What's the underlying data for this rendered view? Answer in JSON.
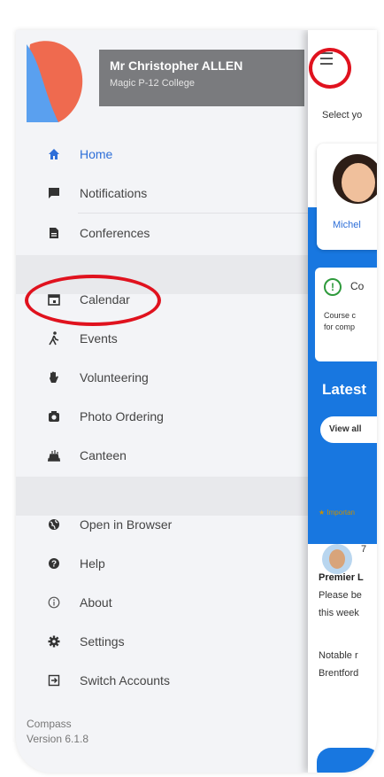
{
  "profile": {
    "name": "Mr Christopher ALLEN",
    "school": "Magic P-12 College"
  },
  "menu_group_1": [
    {
      "label": "Home",
      "icon": "home-icon",
      "active": true
    },
    {
      "label": "Notifications",
      "icon": "notifications-icon"
    },
    {
      "label": "Conferences",
      "icon": "document-icon"
    }
  ],
  "menu_group_2": [
    {
      "label": "Calendar",
      "icon": "calendar-icon"
    },
    {
      "label": "Events",
      "icon": "walk-icon"
    },
    {
      "label": "Volunteering",
      "icon": "hand-icon"
    },
    {
      "label": "Photo Ordering",
      "icon": "camera-icon"
    },
    {
      "label": "Canteen",
      "icon": "canteen-icon"
    }
  ],
  "menu_group_3": [
    {
      "label": "Open in Browser",
      "icon": "globe-icon"
    },
    {
      "label": "Help",
      "icon": "help-icon"
    },
    {
      "label": "About",
      "icon": "info-icon"
    },
    {
      "label": "Settings",
      "icon": "gear-icon"
    },
    {
      "label": "Switch Accounts",
      "icon": "switch-icon"
    }
  ],
  "footer": {
    "app": "Compass",
    "version": "Version 6.1.8"
  },
  "content": {
    "select_text": "Select yo",
    "person_name": "Michel",
    "notice_title": "Co",
    "notice_line1": "Course c",
    "notice_line2": "for comp",
    "latest": "Latest",
    "view_all": "View all",
    "important": "Importan",
    "post_num": "7",
    "post_title": "Premier L",
    "post_line1": "Please be",
    "post_line2": "this week",
    "post_line3": "Notable r",
    "post_line4": "Brentford"
  },
  "colors": {
    "accent": "#2e6fd8",
    "brand_blue": "#1877e0",
    "annotation_red": "#e0121e"
  }
}
